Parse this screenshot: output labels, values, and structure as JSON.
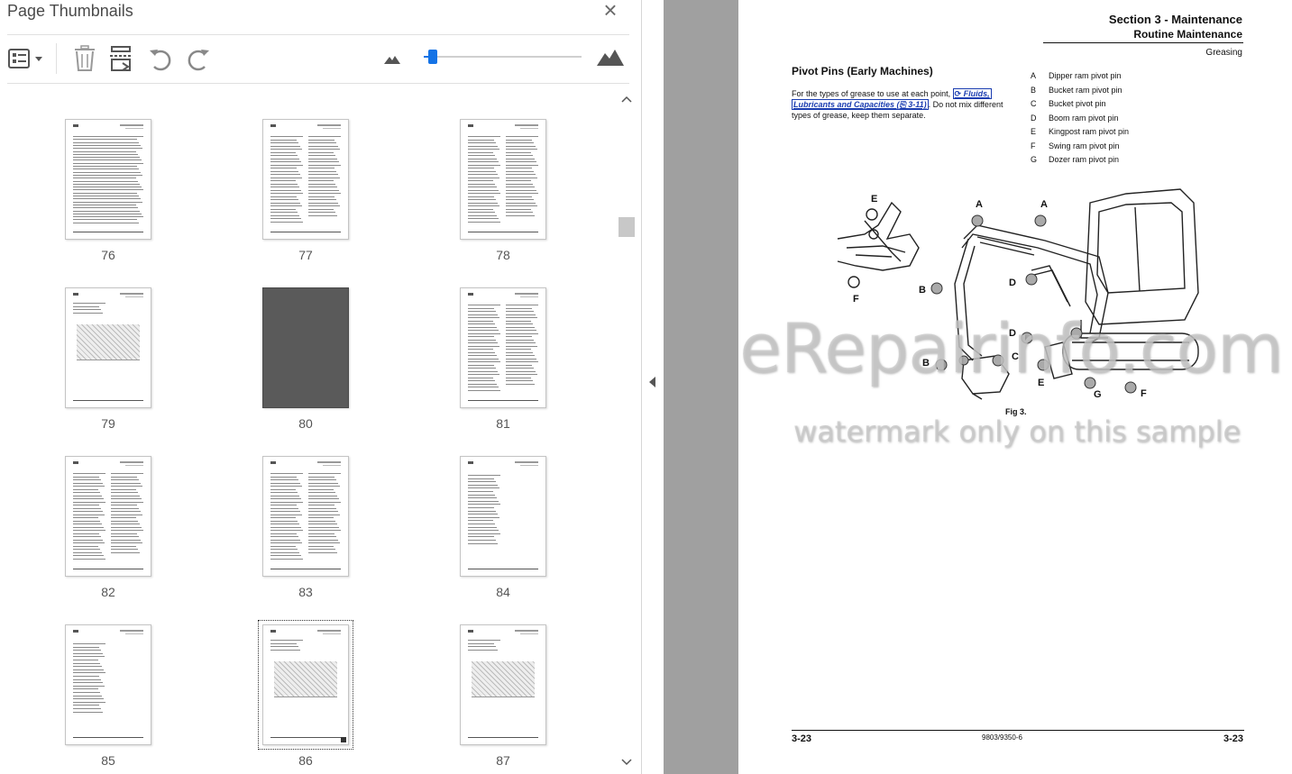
{
  "panel": {
    "title": "Page Thumbnails",
    "close_icon": "×",
    "toolbar": {
      "options_icon": "thumbnail-options-icon",
      "delete_icon": "trash-icon",
      "extract_icon": "extract-pages-icon",
      "rotate_ccw_icon": "rotate-counterclockwise-icon",
      "rotate_cw_icon": "rotate-clockwise-icon",
      "zoom_small_icon": "mountain-small-icon",
      "zoom_large_icon": "mountain-large-icon",
      "zoom_slider_level": 0.04,
      "accent_color": "#1473e6"
    },
    "thumbnails": [
      {
        "page": "76"
      },
      {
        "page": "77"
      },
      {
        "page": "78"
      },
      {
        "page": "79"
      },
      {
        "page": "80"
      },
      {
        "page": "81"
      },
      {
        "page": "82"
      },
      {
        "page": "83"
      },
      {
        "page": "84"
      },
      {
        "page": "85"
      },
      {
        "page": "86"
      },
      {
        "page": "87"
      }
    ],
    "selected_page": "86"
  },
  "document": {
    "section_title": "Section 3 - Maintenance",
    "section_subtitle": "Routine Maintenance",
    "topic": "Greasing",
    "heading": "Pivot Pins (Early Machines)",
    "para_before": "For the types of grease to use at each point, ",
    "para_link1": "⟳ Fluids,",
    "para_link2": "Lubricants and Capacities (⎘ 3-11)",
    "para_after": ". Do not mix different types of grease, keep them separate.",
    "legend": [
      {
        "key": "A",
        "label": "Dipper ram pivot pin"
      },
      {
        "key": "B",
        "label": "Bucket ram pivot pin"
      },
      {
        "key": "C",
        "label": "Bucket pivot pin"
      },
      {
        "key": "D",
        "label": "Boom ram pivot pin"
      },
      {
        "key": "E",
        "label": "Kingpost ram pivot pin"
      },
      {
        "key": "F",
        "label": "Swing ram pivot pin"
      },
      {
        "key": "G",
        "label": "Dozer ram pivot pin"
      }
    ],
    "figure_labels": {
      "e1": "E",
      "f1": "F",
      "a1": "A",
      "a2": "A",
      "b1": "B",
      "d1": "D",
      "d2": "D",
      "b2": "B",
      "c1": "C",
      "e2": "E",
      "g1": "G",
      "f2": "F"
    },
    "figure_caption": "Fig 3.",
    "footer_left": "3-23",
    "footer_mid": "9803/9350-6",
    "footer_right": "3-23",
    "watermark_main": "eRepairinfo.com",
    "watermark_sub": "watermark only on this sample"
  }
}
